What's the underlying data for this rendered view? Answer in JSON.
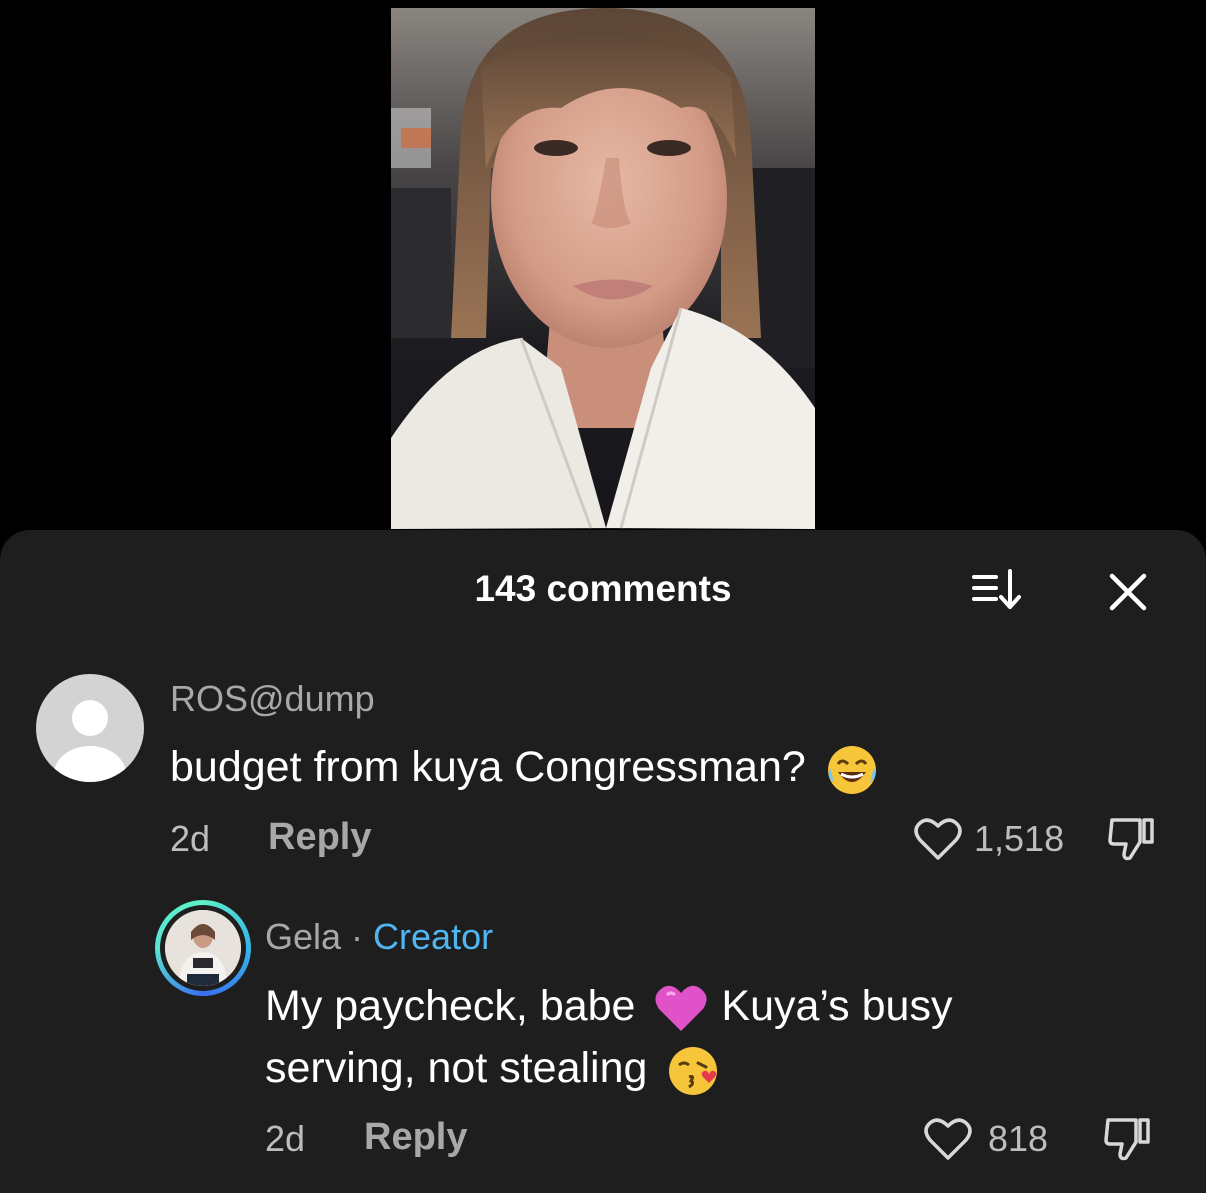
{
  "sheet": {
    "title": "143 comments",
    "sort_icon": "sort-icon",
    "close_icon": "close-icon"
  },
  "comments": [
    {
      "username": "ROS@dump",
      "text": "budget from kuya Congressman?",
      "emoji": "😂",
      "time": "2d",
      "reply_label": "Reply",
      "likes": "1,518",
      "avatar": "default-avatar-icon"
    }
  ],
  "replies": [
    {
      "username": "Gela",
      "separator": " · ",
      "badge": "Creator",
      "text_line1": "My paycheck, babe",
      "emoji1": "💗",
      "text_line1b": "Kuya’s busy",
      "text_line2": "serving, not stealing",
      "emoji2": "😘",
      "time": "2d",
      "reply_label": "Reply",
      "likes": "818"
    }
  ],
  "colors": {
    "background": "#000000",
    "sheet": "#1e1e1e",
    "creator": "#4fb6f2",
    "muted": "#a8a8a8"
  }
}
